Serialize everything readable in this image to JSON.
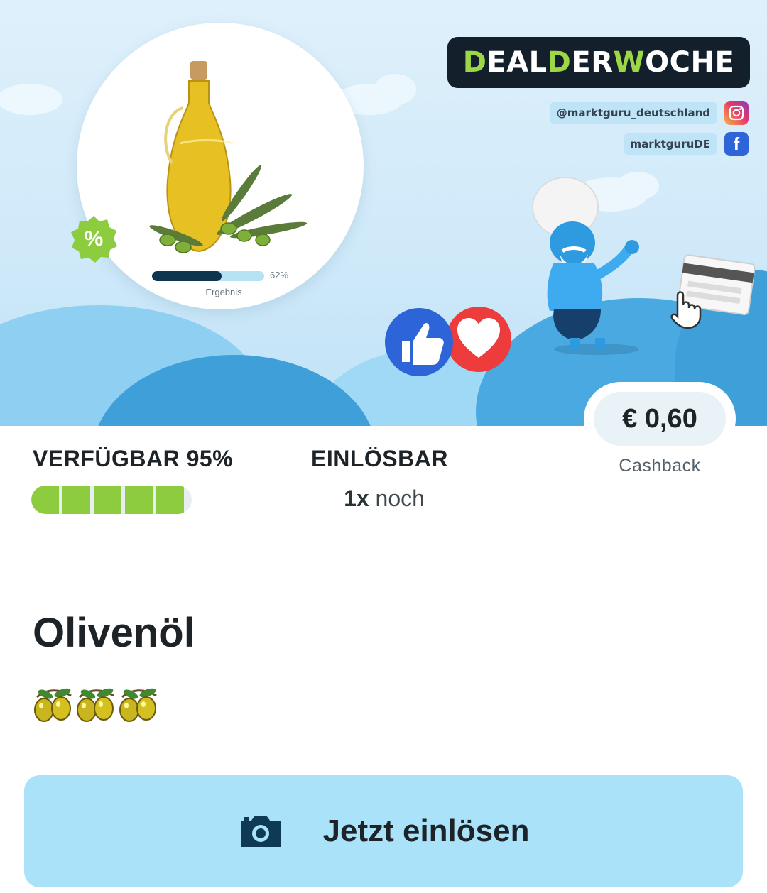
{
  "banner": {
    "deal_title_parts": [
      "D",
      "EAL ",
      "D",
      "ER ",
      "W",
      "OCHE"
    ],
    "instagram_handle": "@marktguru_deutschland",
    "facebook_handle": "marktguruDE",
    "percent_badge": "%",
    "result_percent_value": 0.62,
    "result_percent_label": "62%",
    "result_label": "Ergebnis",
    "icons": [
      "olive-oil-bottle-icon",
      "percent-icon",
      "instagram-icon",
      "facebook-icon",
      "thumbs-up-icon",
      "heart-icon",
      "mascot-illustration",
      "card-tap-icon"
    ]
  },
  "availability": {
    "label": "VERFÜGBAR 95%",
    "value": 0.95,
    "segments": 5
  },
  "redeemable": {
    "label": "EINLÖSBAR",
    "count": "1x",
    "suffix": " noch"
  },
  "cashback": {
    "amount": "€ 0,60",
    "label": "Cashback"
  },
  "product": {
    "title": "Olivenöl",
    "emoji_count": 3,
    "emoji_icon": "olive-icon"
  },
  "cta": {
    "label": "Jetzt einlösen",
    "icon": "camera-icon"
  },
  "colors": {
    "brand_green": "#9dd646",
    "availability_green": "#8ccc3e",
    "cta_background": "#a9e2f9",
    "badge_dark": "#13202b",
    "like_blue": "#2d64d8",
    "heart_red": "#ee3b3b"
  }
}
